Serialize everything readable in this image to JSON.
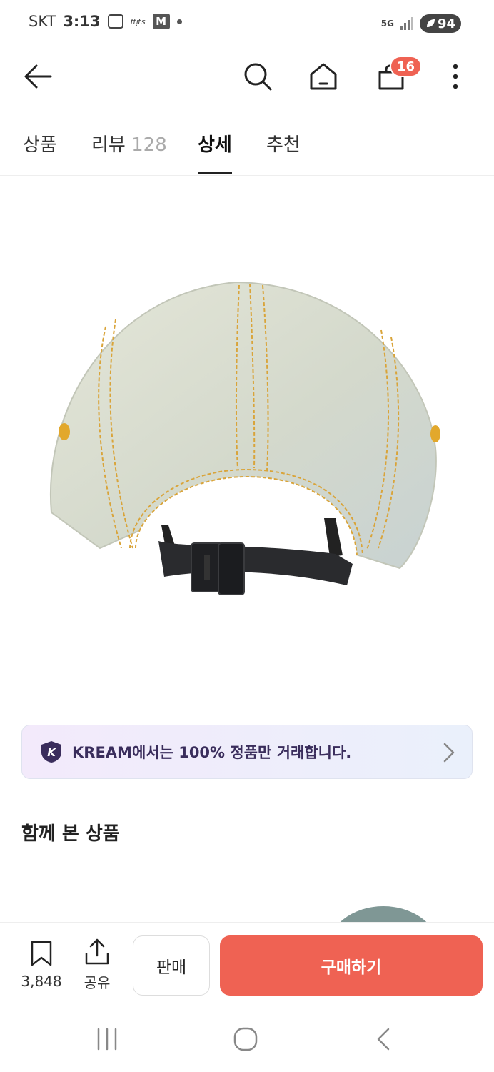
{
  "status_bar": {
    "carrier": "SKT",
    "time": "3:13",
    "mini_text": "ffᴉƭs",
    "m_icon": "M",
    "network": "5G",
    "battery": "94"
  },
  "top_bar": {
    "back_icon": "arrow-left-icon",
    "search_icon": "search-icon",
    "home_icon": "home-icon",
    "bag_icon": "shopping-bag-icon",
    "cart_count": "16",
    "more_icon": "more-vertical-icon"
  },
  "tabs": [
    {
      "label": "상품",
      "count": ""
    },
    {
      "label": "리뷰",
      "count": "128"
    },
    {
      "label": "상세",
      "count": ""
    },
    {
      "label": "추천",
      "count": ""
    }
  ],
  "active_tab": "상세",
  "banner": {
    "text": "KREAM에서는 100% 정품만 거래합니다.",
    "logo_letter": "K"
  },
  "related": {
    "title": "함께 본 상품"
  },
  "action_bar": {
    "bookmark_count": "3,848",
    "share_label": "공유",
    "sell_label": "판매",
    "buy_label": "구매하기"
  },
  "colors": {
    "accent": "#ef6253",
    "banner_text": "#3a2d5c",
    "cap_denim": "#d9ddcf",
    "stitch": "#d9a43a"
  }
}
